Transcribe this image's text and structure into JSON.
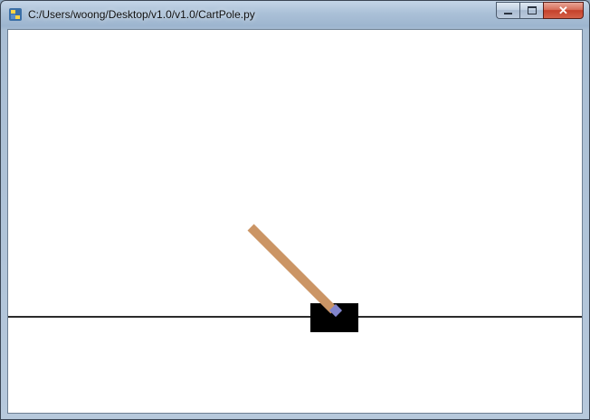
{
  "window": {
    "title": "C:/Users/woong/Desktop/v1.0/v1.0/CartPole.py",
    "close_glyph": "✕"
  },
  "colors": {
    "canvas_background": "#ffffff",
    "track": "#2b2b2b",
    "cart": "#000000",
    "pole": "#cb9565",
    "axle": "#8184cc"
  },
  "icons": {
    "app_icon": "python-icon",
    "minimize": "minimize-icon",
    "maximize": "maximize-icon",
    "close": "close-icon"
  }
}
